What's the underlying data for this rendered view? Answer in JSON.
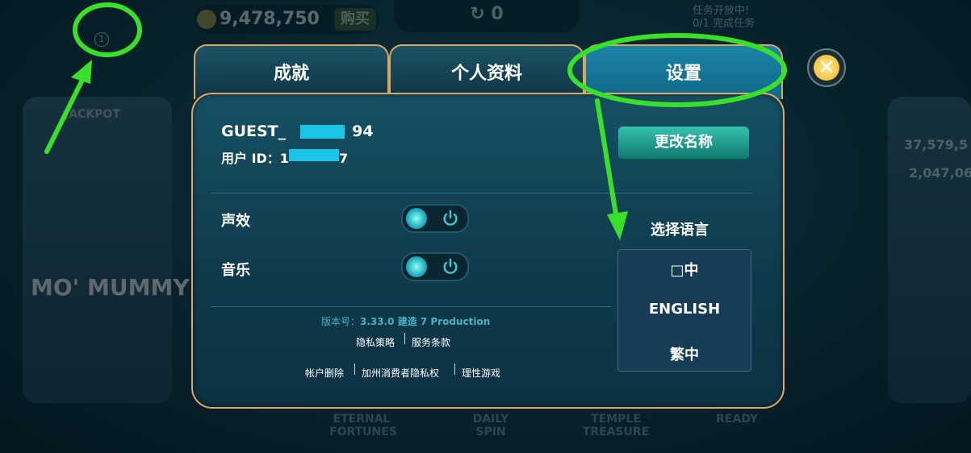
{
  "background": {
    "coins_value": "9,478,750",
    "buy_label": "购买",
    "spin_count": "0",
    "mission_line1": "任务开放中!",
    "mission_line2": "0/1 完成任务",
    "left_game_jackpot": "JACKPOT",
    "left_game_title": "MO' MUMMY",
    "right_game_value1": "37,579,5",
    "right_game_value2": "2,047,06",
    "level_badge": "1",
    "bottom_labels": [
      "ETERNAL FORTUNES",
      "DAILY SPIN",
      "TEMPLE TREASURE",
      "READY"
    ]
  },
  "tabs": [
    {
      "label": "成就",
      "active": false
    },
    {
      "label": "个人资料",
      "active": false
    },
    {
      "label": "设置",
      "active": true
    }
  ],
  "profile": {
    "guest_prefix": "GUEST_",
    "guest_suffix": "94",
    "user_id_label": "用户 ID：1",
    "user_id_suffix": "7",
    "rename_button": "更改名称"
  },
  "settings": {
    "sound_label": "声效",
    "music_label": "音乐",
    "sound_on": true,
    "music_on": true
  },
  "language": {
    "title": "选择语言",
    "options": [
      "□中",
      "ENGLISH",
      "繁中"
    ]
  },
  "footer": {
    "version_label": "版本号：",
    "version_value": "3.33.0 建造 7 Production",
    "privacy": "隐私策略",
    "terms": "服务条款",
    "delete_account": "帐户删除",
    "california_privacy": "加州消费者隐私权",
    "responsible_gaming": "理性游戏"
  },
  "colors": {
    "annotation_green": "#39e02a",
    "panel_border": "#e2a46a",
    "active_tab": "#1b84a8",
    "redaction": "#19c4e7"
  }
}
